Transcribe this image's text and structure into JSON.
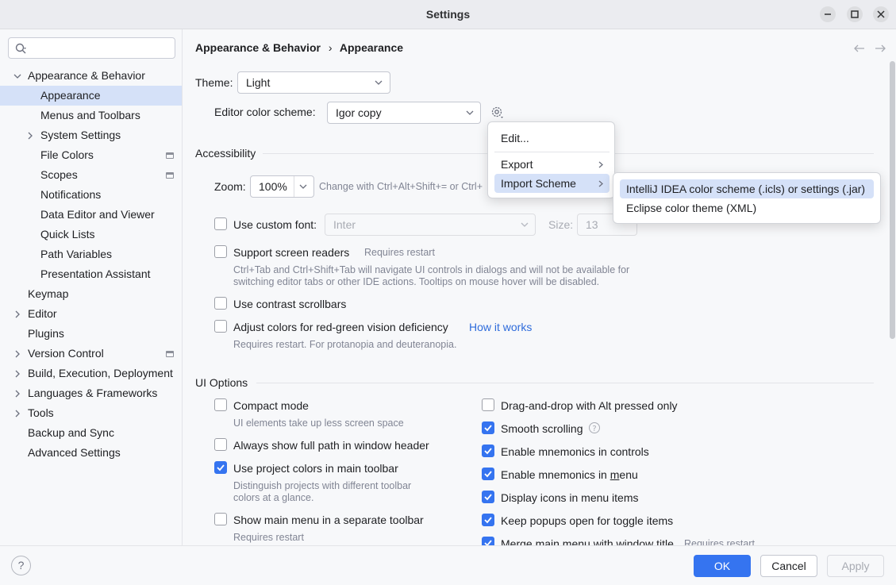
{
  "window": {
    "title": "Settings"
  },
  "sidebar": {
    "search_placeholder": "",
    "items": [
      {
        "label": "Appearance & Behavior",
        "level": 0,
        "expanded": true
      },
      {
        "label": "Appearance",
        "level": 1,
        "selected": true
      },
      {
        "label": "Menus and Toolbars",
        "level": 1
      },
      {
        "label": "System Settings",
        "level": 1,
        "collapsed": true
      },
      {
        "label": "File Colors",
        "level": 1,
        "project": true
      },
      {
        "label": "Scopes",
        "level": 1,
        "project": true
      },
      {
        "label": "Notifications",
        "level": 1
      },
      {
        "label": "Data Editor and Viewer",
        "level": 1
      },
      {
        "label": "Quick Lists",
        "level": 1
      },
      {
        "label": "Path Variables",
        "level": 1
      },
      {
        "label": "Presentation Assistant",
        "level": 1
      },
      {
        "label": "Keymap",
        "level": 0
      },
      {
        "label": "Editor",
        "level": 0,
        "collapsed": true
      },
      {
        "label": "Plugins",
        "level": 0
      },
      {
        "label": "Version Control",
        "level": 0,
        "collapsed": true,
        "project": true
      },
      {
        "label": "Build, Execution, Deployment",
        "level": 0,
        "collapsed": true
      },
      {
        "label": "Languages & Frameworks",
        "level": 0,
        "collapsed": true
      },
      {
        "label": "Tools",
        "level": 0,
        "collapsed": true
      },
      {
        "label": "Backup and Sync",
        "level": 0
      },
      {
        "label": "Advanced Settings",
        "level": 0
      }
    ]
  },
  "breadcrumb": {
    "parent": "Appearance & Behavior",
    "separator": "›",
    "current": "Appearance"
  },
  "theme": {
    "label": "Theme:",
    "value": "Light"
  },
  "editor_scheme": {
    "label": "Editor color scheme:",
    "value": "Igor copy"
  },
  "accessibility": {
    "title": "Accessibility",
    "zoom_label": "Zoom:",
    "zoom_value": "100%",
    "zoom_hint": "Change with Ctrl+Alt+Shift+= or Ctrl+",
    "custom_font_label": "Use custom font:",
    "custom_font_value": "Inter",
    "size_label": "Size:",
    "size_value": "13",
    "screen_readers_label": "Support screen readers",
    "screen_readers_hint": "Requires restart",
    "screen_readers_desc1": "Ctrl+Tab and Ctrl+Shift+Tab will navigate UI controls in dialogs and will not be available for",
    "screen_readers_desc2": "switching editor tabs or other IDE actions. Tooltips on mouse hover will be disabled.",
    "contrast_label": "Use contrast scrollbars",
    "redgreen_label": "Adjust colors for red-green vision deficiency",
    "redgreen_link": "How it works",
    "redgreen_hint": "Requires restart. For protanopia and deuteranopia."
  },
  "ui_options": {
    "title": "UI Options",
    "left": {
      "compact_label": "Compact mode",
      "compact_hint": "UI elements take up less screen space",
      "fullpath_label": "Always show full path in window header",
      "projcolors_label": "Use project colors in main toolbar",
      "projcolors_hint1": "Distinguish projects with different toolbar",
      "projcolors_hint2": "colors at a glance.",
      "mainmenu_label": "Show main menu in a separate toolbar",
      "mainmenu_hint": "Requires restart"
    },
    "right": {
      "dnd_label": "Drag-and-drop with Alt pressed only",
      "smooth_label": "Smooth scrolling",
      "mnem_controls_label": "Enable mnemonics in controls",
      "mnem_menu_prefix": "Enable mnemonics in ",
      "mnem_menu_mn": "m",
      "mnem_menu_suffix": "enu",
      "icons_label": "Display icons in menu items",
      "popups_label": "Keep popups open for toggle items",
      "merge_label": "Merge main menu with window title",
      "merge_hint": "Requires restart"
    }
  },
  "gear_menu": {
    "edit": "Edit...",
    "export": "Export",
    "import": "Import Scheme"
  },
  "import_submenu": {
    "item1": "IntelliJ IDEA color scheme (.icls) or settings (.jar)",
    "item2": "Eclipse color theme (XML)"
  },
  "footer": {
    "help": "?",
    "ok": "OK",
    "cancel": "Cancel",
    "apply": "Apply"
  },
  "colors": {
    "accent": "#3574f0",
    "selection": "#d5e1f8",
    "link": "#2f6cdb"
  }
}
